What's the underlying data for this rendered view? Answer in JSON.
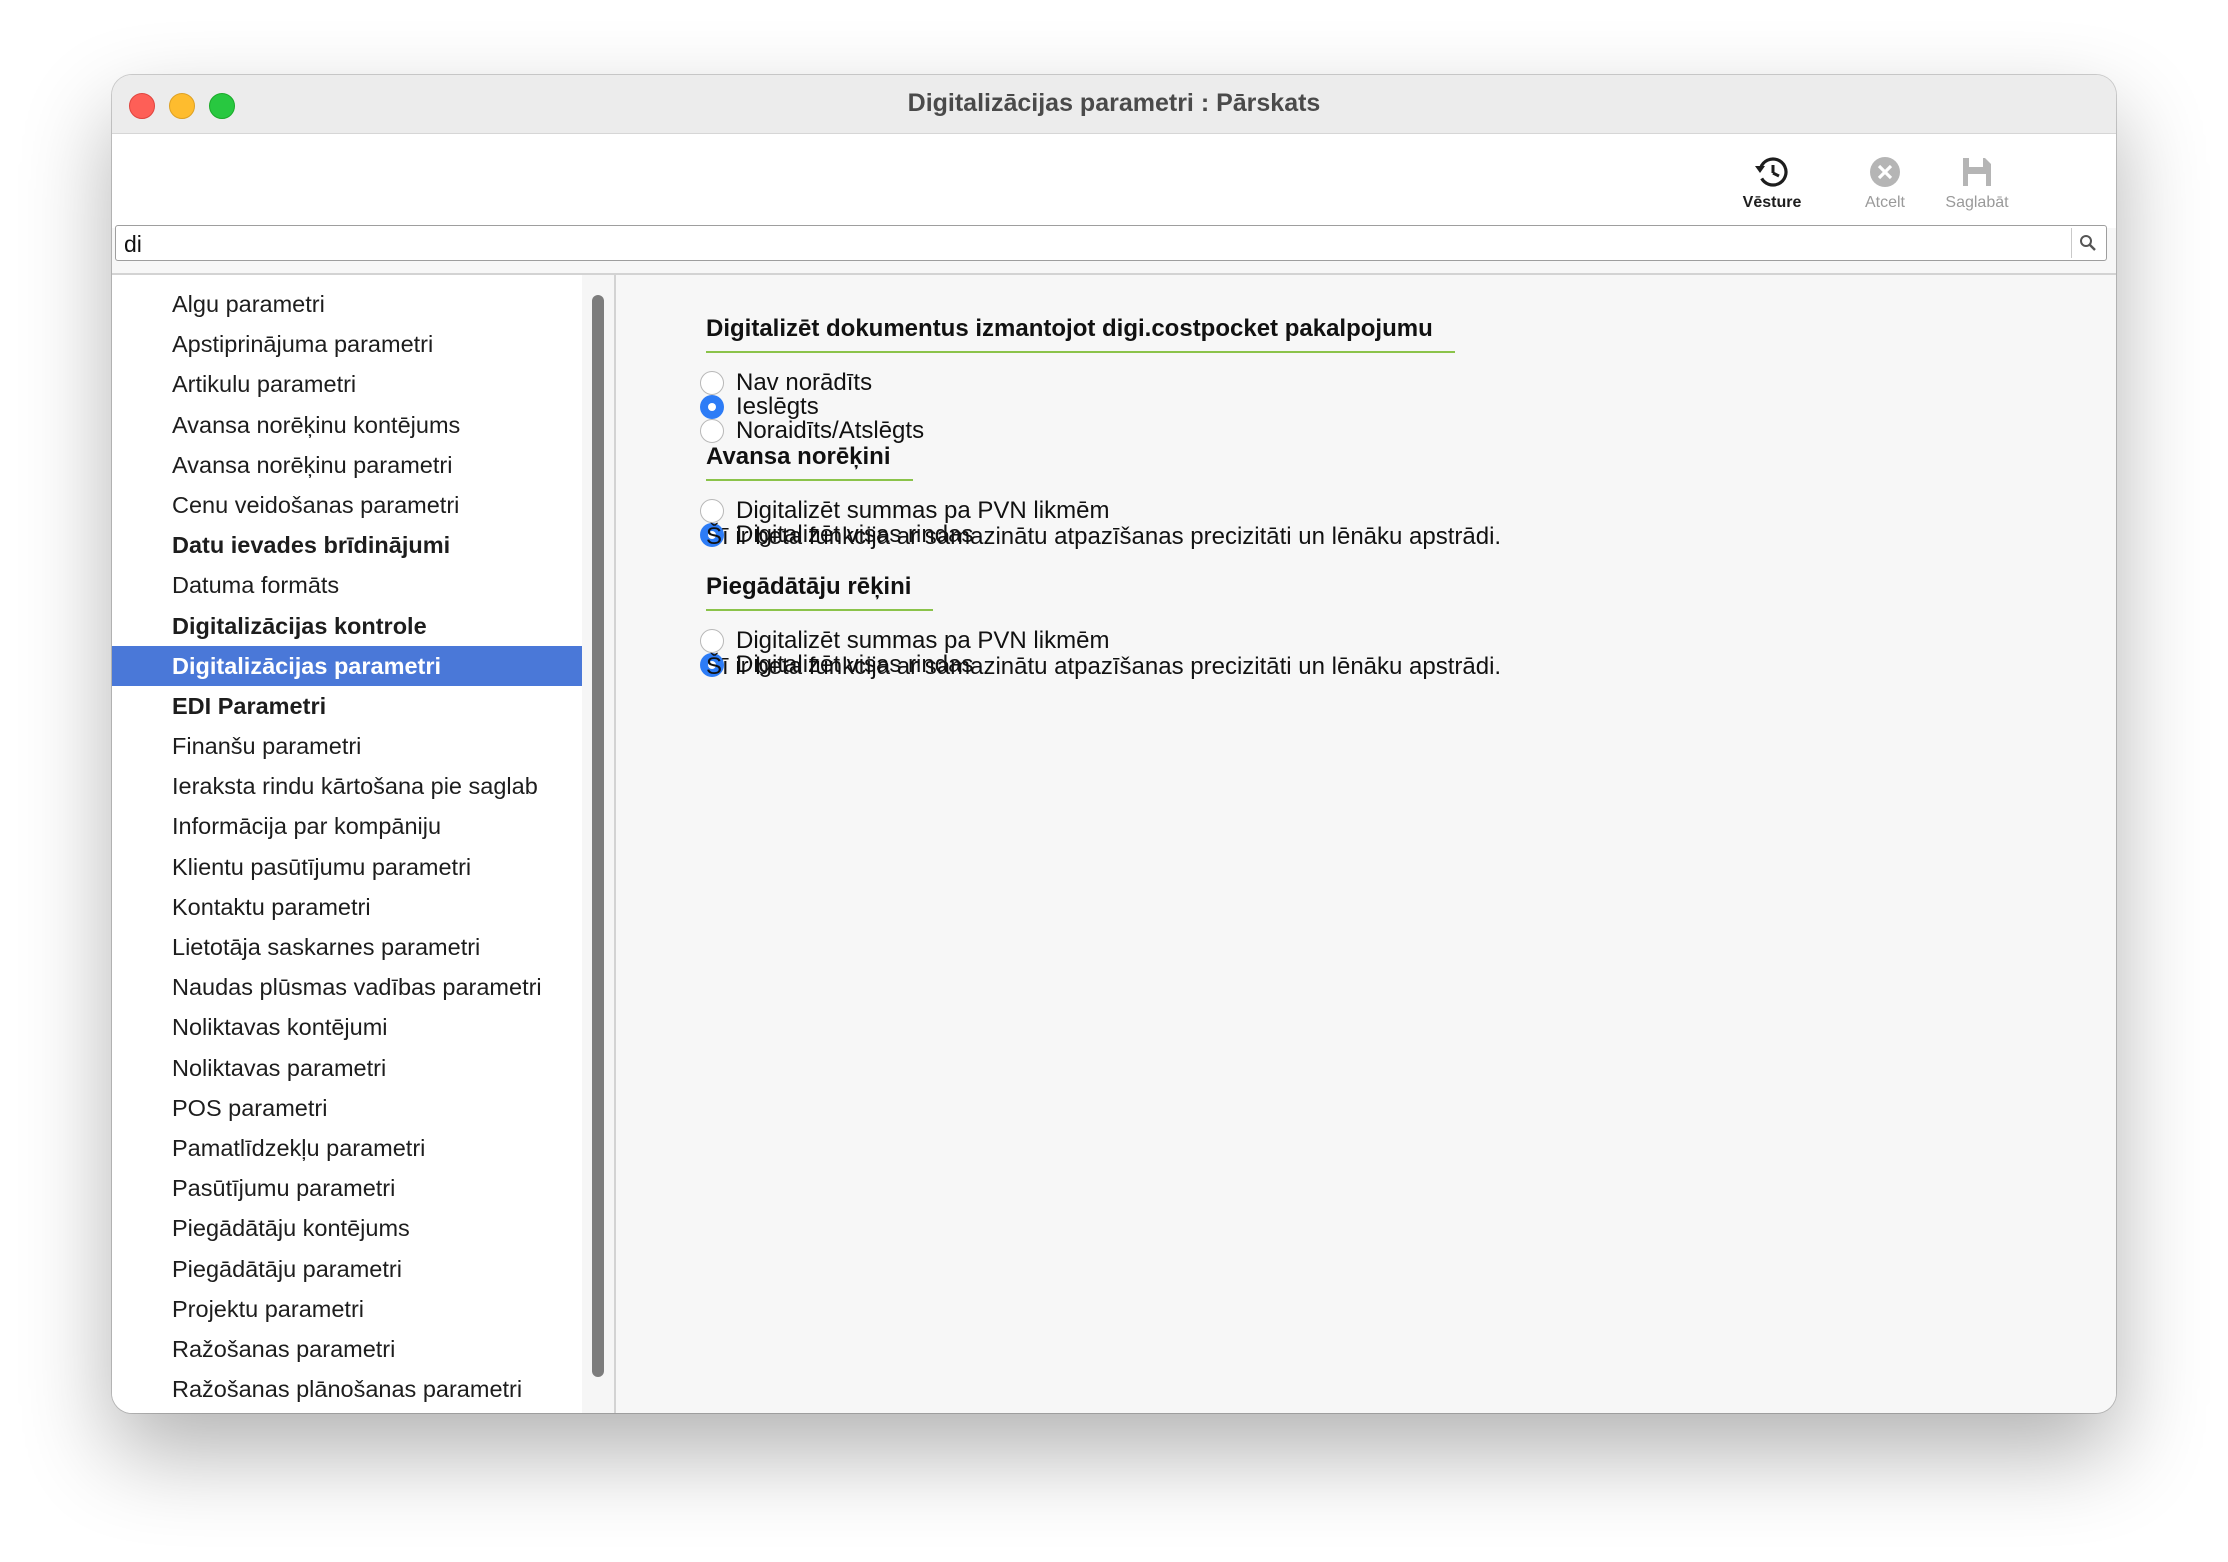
{
  "window": {
    "title": "Digitalizācijas parametri : Pārskats"
  },
  "toolbar": {
    "history_label": "Vēsture",
    "cancel_label": "Atcelt",
    "save_label": "Saglabāt"
  },
  "search": {
    "value": "di"
  },
  "sidebar": {
    "items": [
      {
        "label": "Algu parametri",
        "bold": false,
        "selected": false
      },
      {
        "label": "Apstiprinājuma parametri",
        "bold": false,
        "selected": false
      },
      {
        "label": "Artikulu parametri",
        "bold": false,
        "selected": false
      },
      {
        "label": "Avansa norēķinu kontējums",
        "bold": false,
        "selected": false
      },
      {
        "label": "Avansa norēķinu parametri",
        "bold": false,
        "selected": false
      },
      {
        "label": "Cenu veidošanas parametri",
        "bold": false,
        "selected": false
      },
      {
        "label": "Datu ievades brīdinājumi",
        "bold": true,
        "selected": false
      },
      {
        "label": "Datuma formāts",
        "bold": false,
        "selected": false
      },
      {
        "label": "Digitalizācijas kontrole",
        "bold": true,
        "selected": false
      },
      {
        "label": "Digitalizācijas parametri",
        "bold": true,
        "selected": true
      },
      {
        "label": "EDI Parametri",
        "bold": true,
        "selected": false
      },
      {
        "label": "Finanšu parametri",
        "bold": false,
        "selected": false
      },
      {
        "label": "Ieraksta rindu kārtošana pie saglab",
        "bold": false,
        "selected": false
      },
      {
        "label": "Informācija par kompāniju",
        "bold": false,
        "selected": false
      },
      {
        "label": "Klientu pasūtījumu parametri",
        "bold": false,
        "selected": false
      },
      {
        "label": "Kontaktu parametri",
        "bold": false,
        "selected": false
      },
      {
        "label": "Lietotāja saskarnes parametri",
        "bold": false,
        "selected": false
      },
      {
        "label": "Naudas plūsmas vadības parametri",
        "bold": false,
        "selected": false
      },
      {
        "label": "Noliktavas kontējumi",
        "bold": false,
        "selected": false
      },
      {
        "label": "Noliktavas parametri",
        "bold": false,
        "selected": false
      },
      {
        "label": "POS parametri",
        "bold": false,
        "selected": false
      },
      {
        "label": "Pamatlīdzekļu parametri",
        "bold": false,
        "selected": false
      },
      {
        "label": "Pasūtījumu parametri",
        "bold": false,
        "selected": false
      },
      {
        "label": "Piegādātāju kontējums",
        "bold": false,
        "selected": false
      },
      {
        "label": "Piegādātāju parametri",
        "bold": false,
        "selected": false
      },
      {
        "label": "Projektu parametri",
        "bold": false,
        "selected": false
      },
      {
        "label": "Ražošanas parametri",
        "bold": false,
        "selected": false
      },
      {
        "label": "Ražošanas plānošanas parametri",
        "bold": false,
        "selected": false
      }
    ]
  },
  "main": {
    "digitize_section": {
      "title": "Digitalizēt dokumentus izmantojot digi.costpocket pakalpojumu",
      "options": [
        {
          "label": "Nav norādīts",
          "checked": false
        },
        {
          "label": "Ieslēgts",
          "checked": true
        },
        {
          "label": "Noraidīts/Atslēgts",
          "checked": false
        }
      ]
    },
    "advance_section": {
      "title": "Avansa norēķini",
      "options": [
        {
          "label": "Digitalizēt summas pa PVN likmēm",
          "checked": false
        },
        {
          "label": "Digitalizēt visas rindas",
          "checked": true
        }
      ],
      "note": "Šī ir beta funkcija ar samazinātu atpazīšanas precizitāti un lēnāku apstrādi."
    },
    "supplier_section": {
      "title": "Piegādātāju rēķini",
      "options": [
        {
          "label": "Digitalizēt summas pa PVN likmēm",
          "checked": false
        },
        {
          "label": "Digitalizēt visas rindas",
          "checked": true
        }
      ],
      "note": "Šī ir beta funkcija ar samazinātu atpazīšanas precizitāti un lēnāku apstrādi."
    }
  },
  "colors": {
    "selection": "#4a78d8",
    "radio_on": "#2d7cf6",
    "section_underline": "#8bc34a"
  }
}
